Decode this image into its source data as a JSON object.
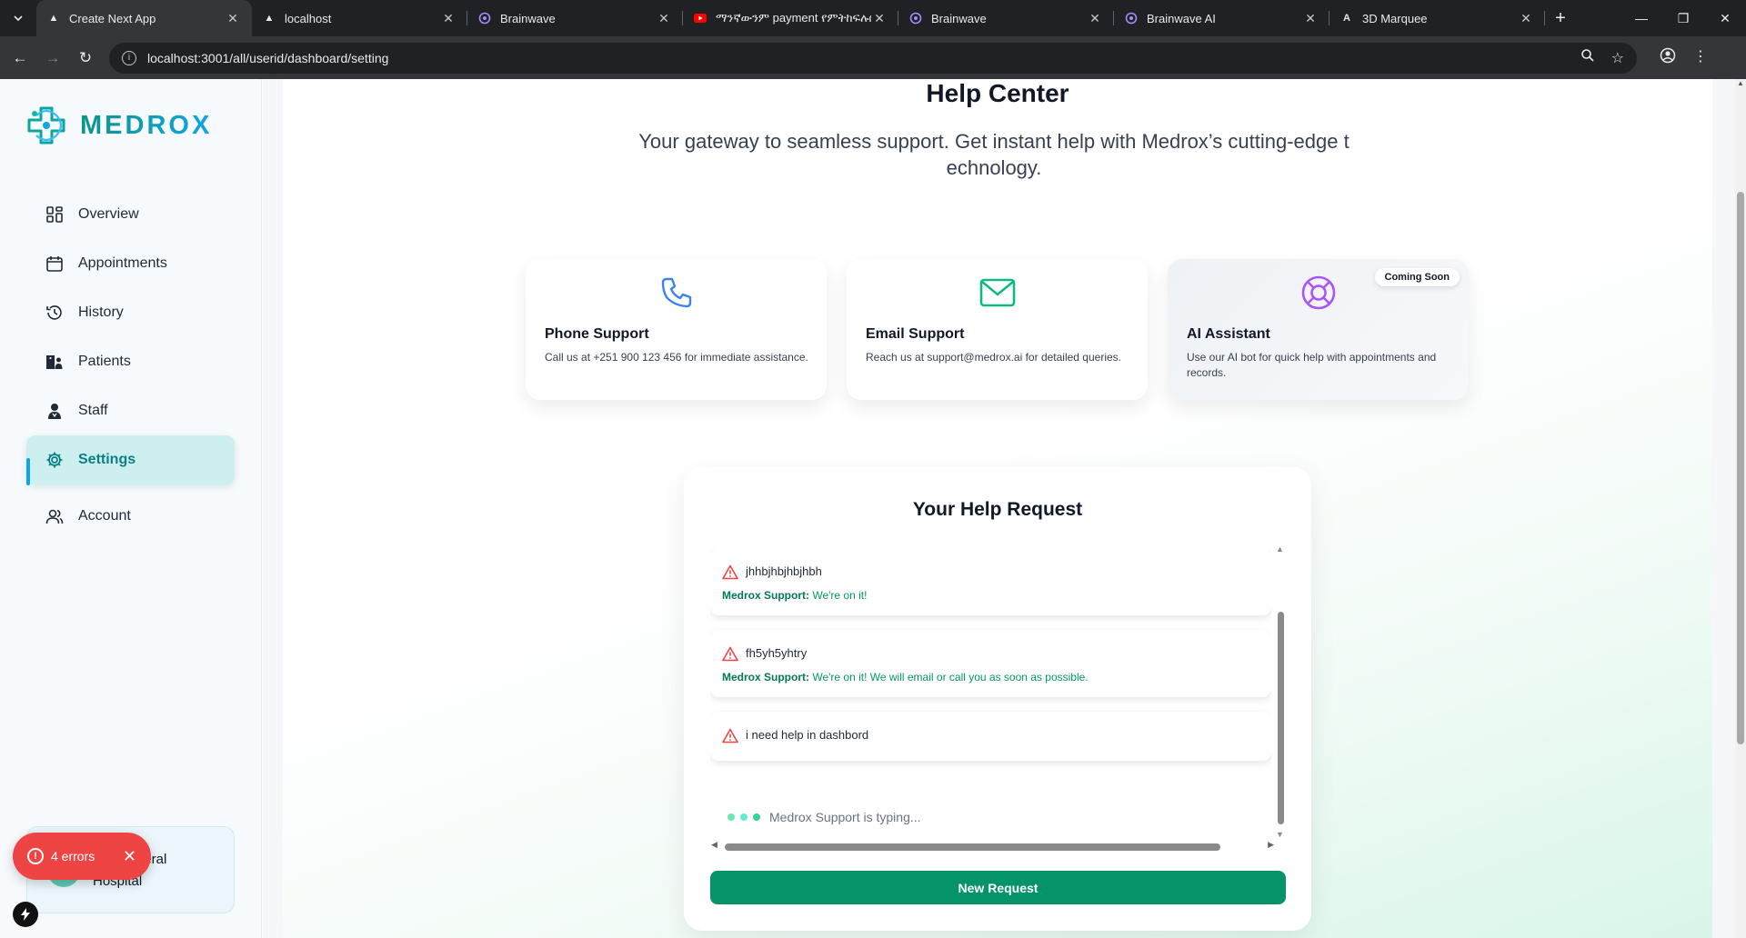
{
  "browser": {
    "tabs": [
      {
        "title": "Create Next App",
        "icon": "triangle-icon",
        "active": true
      },
      {
        "title": "localhost",
        "icon": "triangle-icon",
        "active": false
      },
      {
        "title": "Brainwave",
        "icon": "brainwave-icon",
        "active": false
      },
      {
        "title": "ማንኛውንም payment የምትከፍሉበት",
        "icon": "youtube-icon",
        "active": false
      },
      {
        "title": "Brainwave",
        "icon": "brainwave-icon",
        "active": false
      },
      {
        "title": "Brainwave AI",
        "icon": "brainwave-icon",
        "active": false
      },
      {
        "title": "3D Marquee",
        "icon": "marquee-icon",
        "active": false
      }
    ],
    "url": "localhost:3001/all/userid/dashboard/setting"
  },
  "sidebar": {
    "brand": "MEDROX",
    "items": [
      {
        "label": "Overview",
        "icon": "grid-icon"
      },
      {
        "label": "Appointments",
        "icon": "calendar-icon"
      },
      {
        "label": "History",
        "icon": "history-icon"
      },
      {
        "label": "Patients",
        "icon": "patients-icon"
      },
      {
        "label": "Staff",
        "icon": "staff-icon"
      },
      {
        "label": "Settings",
        "icon": "gear-icon",
        "active": true
      },
      {
        "label": "Account",
        "icon": "users-icon"
      }
    ],
    "hospital_line1": "neral",
    "hospital_line2": "Hospital"
  },
  "dev_overlay": {
    "errors_label": "4 errors",
    "badge": "N"
  },
  "help": {
    "title": "Help Center",
    "subtitle": "Your gateway to seamless support. Get instant help with   Medrox’s cutting-edge t echnology.",
    "cards": [
      {
        "title": "Phone Support",
        "text": "Call us at +251 900 123 456 for immediate assistance.",
        "icon": "phone-icon"
      },
      {
        "title": "Email Support",
        "text": "Reach us at support@medrox.ai for detailed queries.",
        "icon": "mail-icon"
      },
      {
        "title": "AI Assistant",
        "text": "Use our AI bot for quick help with appointments and records.",
        "icon": "lifebuoy-icon",
        "badge": "Coming Soon"
      }
    ]
  },
  "requests": {
    "title": "Your Help Request",
    "support_name": "Medrox Support:",
    "items": [
      {
        "question": "jhhbjhbjhbjhbh",
        "reply": "We're on it!"
      },
      {
        "question": "fh5yh5yhtry",
        "reply": "We're on it! We will email or call you as soon as possible."
      },
      {
        "question": "i need help in dashbord",
        "reply": ""
      }
    ],
    "typing": "Medrox Support is typing...",
    "new_button": "New Request"
  },
  "colors": {
    "accent": "#05936a",
    "active_nav": "#cdeff0",
    "error": "#ef4444",
    "reply": "#059669"
  }
}
